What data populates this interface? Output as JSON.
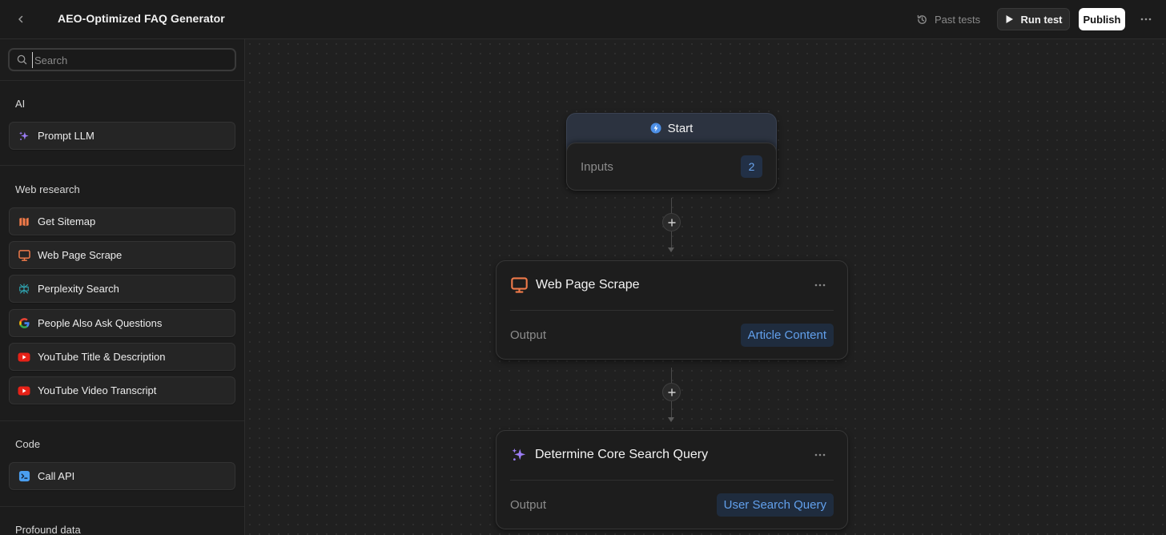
{
  "topbar": {
    "title": "AEO-Optimized FAQ Generator",
    "past_tests_label": "Past tests",
    "run_test_label": "Run test",
    "publish_label": "Publish"
  },
  "sidebar": {
    "search_placeholder": "Search",
    "sections": [
      {
        "label": "AI",
        "items": [
          {
            "label": "Prompt LLM",
            "icon": "sparkle-icon"
          }
        ]
      },
      {
        "label": "Web research",
        "items": [
          {
            "label": "Get Sitemap",
            "icon": "map-icon"
          },
          {
            "label": "Web Page Scrape",
            "icon": "monitor-icon"
          },
          {
            "label": "Perplexity Search",
            "icon": "perplexity-icon"
          },
          {
            "label": "People Also Ask Questions",
            "icon": "google-icon"
          },
          {
            "label": "YouTube Title & Description",
            "icon": "youtube-icon"
          },
          {
            "label": "YouTube Video Transcript",
            "icon": "youtube-icon"
          }
        ]
      },
      {
        "label": "Code",
        "items": [
          {
            "label": "Call API",
            "icon": "terminal-icon"
          }
        ]
      },
      {
        "label": "Profound data",
        "items": []
      }
    ]
  },
  "canvas": {
    "start": {
      "title": "Start",
      "inputs_label": "Inputs",
      "inputs_count": "2"
    },
    "nodes": [
      {
        "title": "Web Page Scrape",
        "icon": "monitor-icon",
        "output_label": "Output",
        "output_value": "Article Content"
      },
      {
        "title": "Determine Core Search Query",
        "icon": "sparkle-icon",
        "output_label": "Output",
        "output_value": "User Search Query"
      }
    ]
  },
  "colors": {
    "accent_blue": "#62a0ec",
    "publish_bg": "#ffffff",
    "scrape_orange": "#f07a4a",
    "llm_purple": "#9b7cf5",
    "youtube_red": "#e62117"
  }
}
